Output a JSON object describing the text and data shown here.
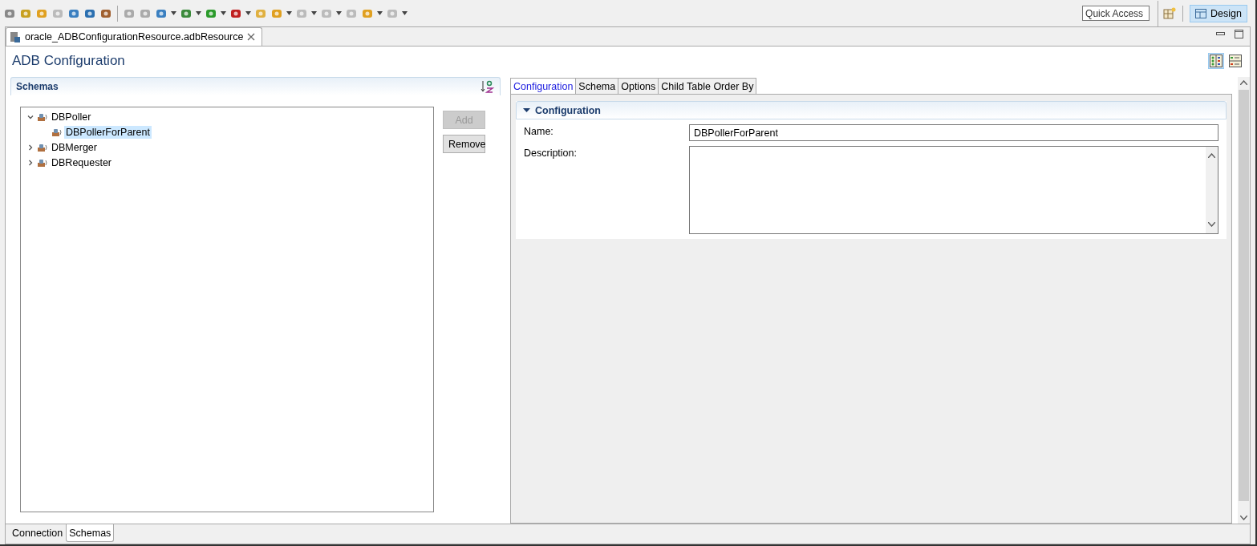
{
  "toolbar": {
    "quick_access": {
      "placeholder": "Quick Access"
    },
    "perspective": {
      "label": "Design",
      "selected": true
    }
  },
  "editor_tab": {
    "title": "oracle_ADBConfigurationResource.adbResource"
  },
  "page_title": "ADB Configuration",
  "view_toggles": [
    {
      "selected": true
    },
    {
      "selected": false
    }
  ],
  "schemas": {
    "title": "Schemas",
    "tree": [
      {
        "label": "DBPoller",
        "expanded": true,
        "selected": false,
        "children": [
          {
            "label": "DBPollerForParent",
            "selected": true
          }
        ]
      },
      {
        "label": "DBMerger",
        "expanded": false,
        "selected": false
      },
      {
        "label": "DBRequester",
        "expanded": false,
        "selected": false
      }
    ],
    "buttons": [
      {
        "label": "Add",
        "disabled": true
      },
      {
        "label": "Remove",
        "disabled": false
      }
    ]
  },
  "detail_tabs": [
    {
      "label": "Configuration",
      "selected": true
    },
    {
      "label": "Schema",
      "selected": false
    },
    {
      "label": "Options",
      "selected": false
    },
    {
      "label": "Child Table Order By",
      "selected": false
    }
  ],
  "configuration": {
    "title": "Configuration",
    "expanded": true,
    "fields": [
      {
        "label": "Name:",
        "kind": "line",
        "value": "DBPollerForParent"
      },
      {
        "label": "Description:",
        "kind": "area"
      }
    ]
  },
  "bottom_tabs": [
    {
      "label": "Connection",
      "selected": false
    },
    {
      "label": "Schemas",
      "selected": true
    }
  ]
}
